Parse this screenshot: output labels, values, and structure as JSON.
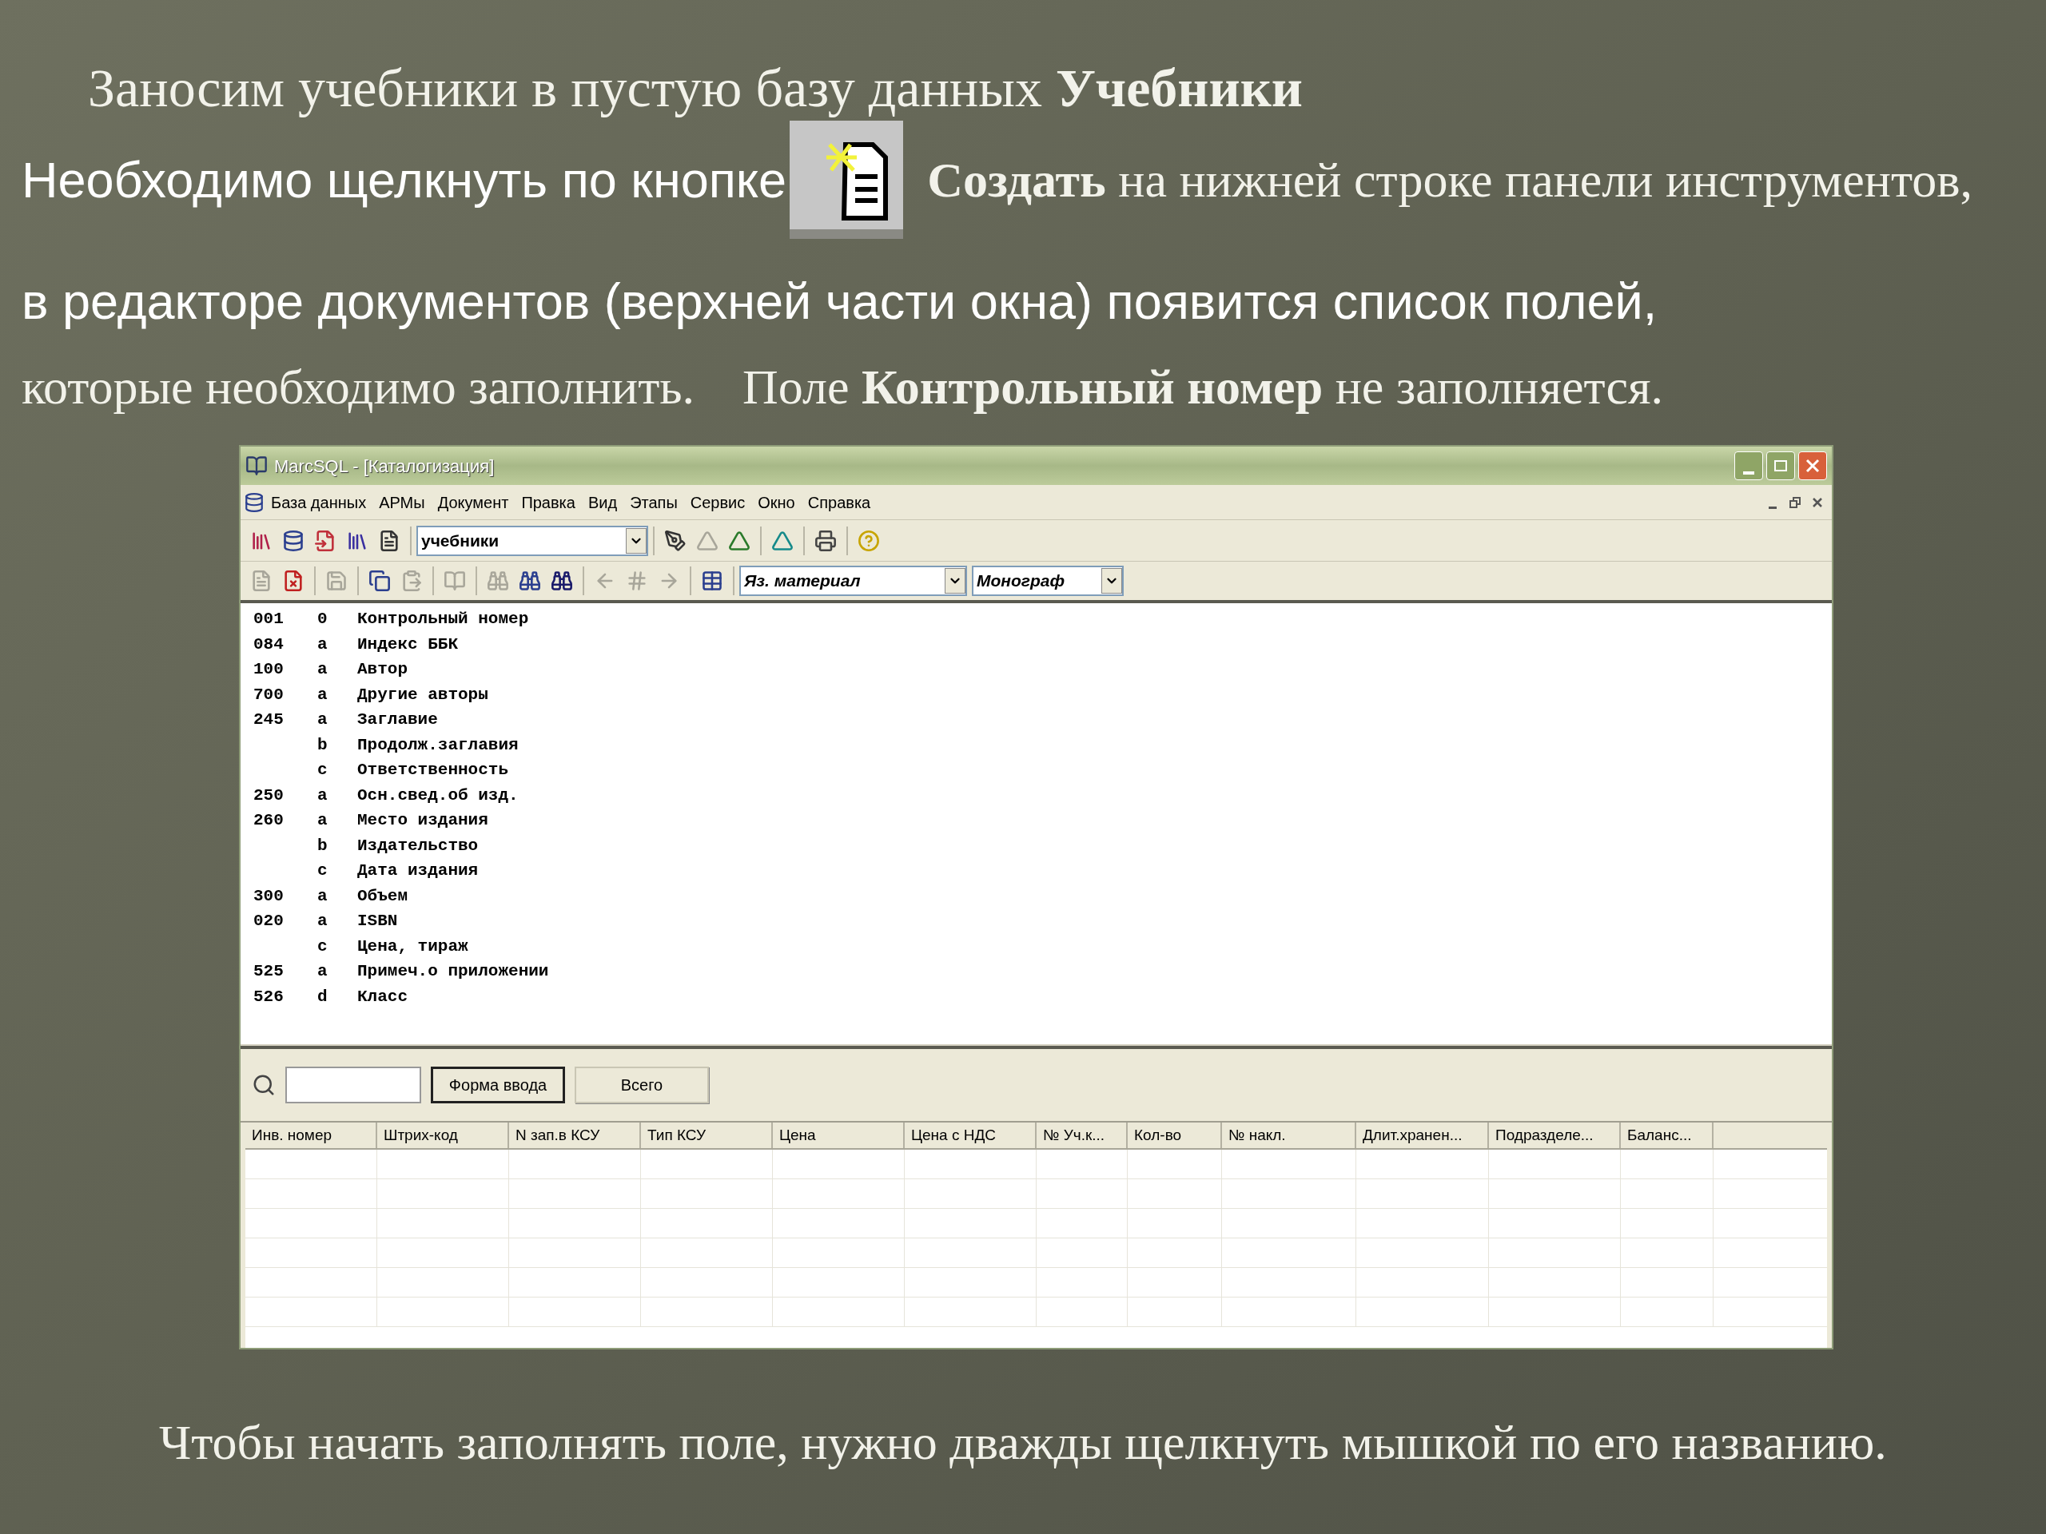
{
  "slide": {
    "heading": "Заносим учебники в пустую базу данных **Учебники**",
    "instruction_lead": "Необходимо щелкнуть по кнопке",
    "instruction_rest": "**Создать** на нижней строке панели инструментов,",
    "line_2": "в редакторе документов (верхней части окна) появится список полей,",
    "line_3": "которые необходимо заполнить.",
    "line_3_note": "Поле **Контрольный номер** не заполняется.",
    "footer": "Чтобы начать заполнять поле, нужно дважды щелкнуть мышкой по его названию."
  },
  "window": {
    "title": "MarcSQL - [Каталогизация]",
    "menu": [
      "База данных",
      "АРМы",
      "Документ",
      "Правка",
      "Вид",
      "Этапы",
      "Сервис",
      "Окно",
      "Справка"
    ],
    "database_select": "учебники",
    "material_select": "Яз. материал",
    "type_select": "Монограф",
    "fields": [
      {
        "tag": "001",
        "code": "0",
        "name": "Контрольный номер"
      },
      {
        "tag": "084",
        "code": "a",
        "name": "Индекс ББК"
      },
      {
        "tag": "100",
        "code": "a",
        "name": "Автор"
      },
      {
        "tag": "700",
        "code": "a",
        "name": "Другие авторы"
      },
      {
        "tag": "245",
        "code": "a",
        "name": "Заглавие"
      },
      {
        "code": "b",
        "name": "Продолж.заглавия"
      },
      {
        "code": "c",
        "name": "Ответственность"
      },
      {
        "tag": "250",
        "code": "a",
        "name": "Осн.свед.об изд."
      },
      {
        "tag": "260",
        "code": "a",
        "name": "Место издания"
      },
      {
        "code": "b",
        "name": "Издательство"
      },
      {
        "code": "c",
        "name": "Дата издания"
      },
      {
        "tag": "300",
        "code": "a",
        "name": "Объем"
      },
      {
        "tag": "020",
        "code": "a",
        "name": "ISBN"
      },
      {
        "code": "c",
        "name": "Цена, тираж"
      },
      {
        "tag": "525",
        "code": "a",
        "name": "Примеч.о приложении"
      },
      {
        "tag": "526",
        "code": "d",
        "name": "Класс"
      }
    ],
    "buttons": [
      {
        "label": "Форма ввода",
        "default": true
      },
      {
        "label": "Всего",
        "default": false
      }
    ],
    "table": {
      "columns": [
        "Инв. номер",
        "Штрих-код",
        "N зап.в КСУ",
        "Тип КСУ",
        "Цена",
        "Цена с НДС",
        "№ Уч.к...",
        "Кол-во",
        "№ накл.",
        "Длит.хранен...",
        "Подразделе...",
        "Баланс..."
      ]
    }
  }
}
